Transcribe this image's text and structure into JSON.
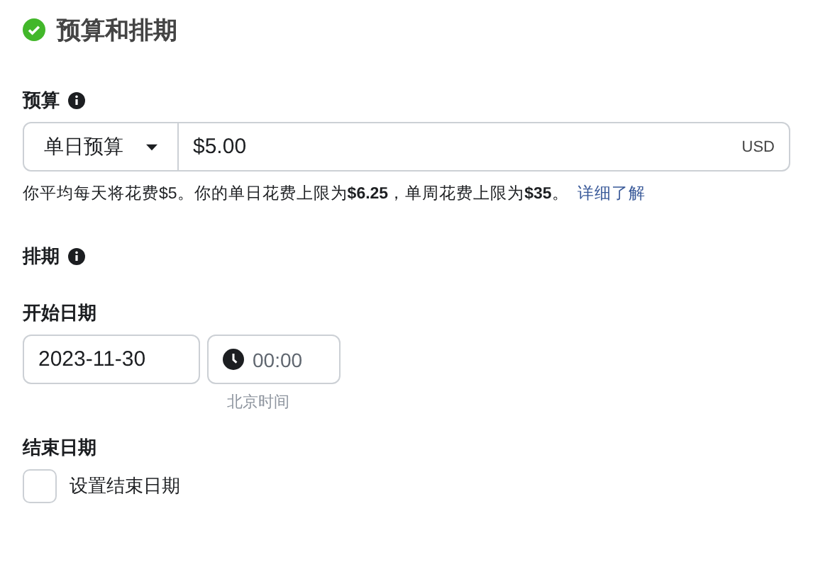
{
  "section": {
    "title": "预算和排期",
    "complete": true
  },
  "budget": {
    "label": "预算",
    "type_select": "单日预算",
    "amount": "$5.00",
    "currency": "USD",
    "help": "你平均每天将花费$5。你的单日花费上限为**$6.25**，单周花费上限为**$35**。",
    "link": "详细了解"
  },
  "schedule": {
    "label": "排期"
  },
  "start": {
    "label": "开始日期",
    "date": "2023-11-30",
    "time": "00:00",
    "timezone": "北京时间"
  },
  "end": {
    "label": "结束日期",
    "checkbox_label": "设置结束日期",
    "checked": false
  }
}
